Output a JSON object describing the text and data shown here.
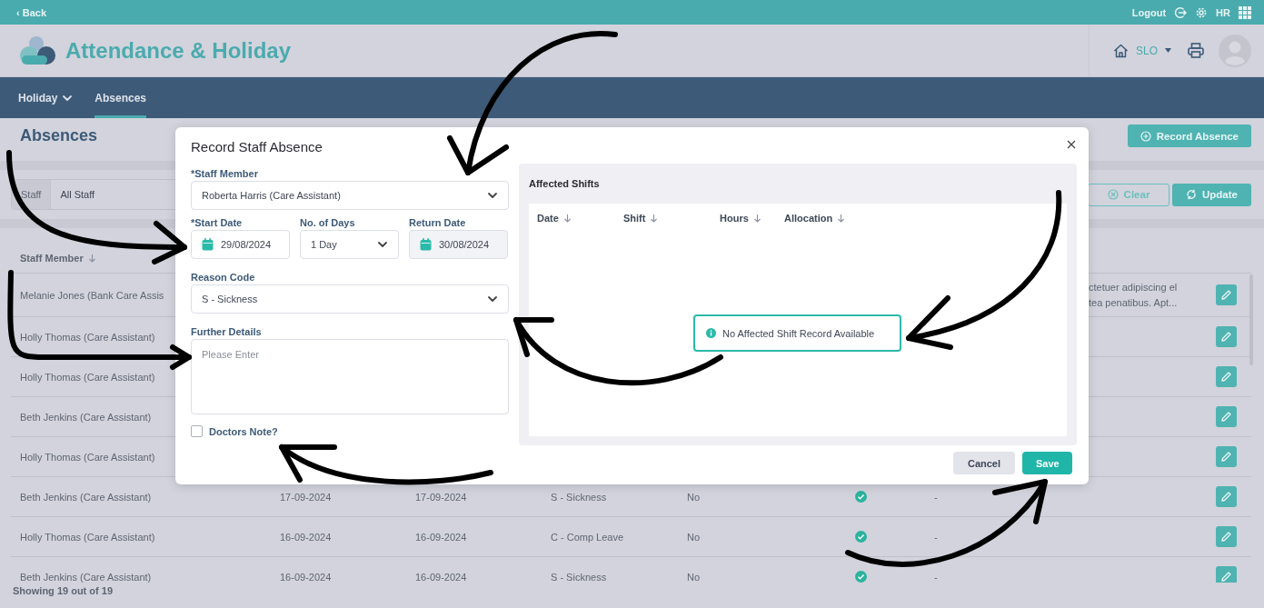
{
  "top_bar": {
    "back": "‹ Back",
    "logout": "Logout",
    "user_initials": "HR"
  },
  "header": {
    "title": "Attendance & Holiday",
    "site": "SLO"
  },
  "nav": {
    "items": [
      {
        "label": "Holiday",
        "has_dropdown": true,
        "selected": false
      },
      {
        "label": "Absences",
        "has_dropdown": false,
        "selected": true
      }
    ]
  },
  "page": {
    "title": "Absences",
    "record_button": "Record Absence"
  },
  "filters": {
    "label": "Staff",
    "value": "All Staff",
    "clear_button": "Clear",
    "update_button": "Update"
  },
  "table": {
    "columns": [
      {
        "label": "Staff Member"
      }
    ],
    "rows": [
      {
        "staff": "Melanie Jones (Bank Care Assis",
        "description": [
          "ctetuer adipiscing el",
          "tea penatibus. Apt..."
        ]
      },
      {
        "staff": "Holly Thomas (Care Assistant)"
      },
      {
        "staff": "Holly Thomas (Care Assistant)"
      },
      {
        "staff": "Beth Jenkins (Care Assistant)"
      },
      {
        "staff": "Holly Thomas (Care Assistant)"
      },
      {
        "staff": "Beth Jenkins (Care Assistant)",
        "start": "17-09-2024",
        "end": "17-09-2024",
        "reason": "S - Sickness",
        "doctors_note": "No",
        "approved": true,
        "notes": "-"
      },
      {
        "staff": "Holly Thomas (Care Assistant)",
        "start": "16-09-2024",
        "end": "16-09-2024",
        "reason": "C - Comp Leave",
        "doctors_note": "No",
        "approved": true,
        "notes": "-"
      },
      {
        "staff": "Beth Jenkins (Care Assistant)",
        "start": "16-09-2024",
        "end": "16-09-2024",
        "reason": "S - Sickness",
        "doctors_note": "No",
        "approved": true,
        "notes": "-"
      }
    ],
    "footer": "Showing 19 out of 19"
  },
  "modal": {
    "title": "Record Staff Absence",
    "staff_member": {
      "label": "*Staff Member",
      "value": "Roberta Harris (Care Assistant)"
    },
    "start_date": {
      "label": "*Start Date",
      "value": "29/08/2024"
    },
    "days": {
      "label": "No. of Days",
      "value": "1 Day"
    },
    "return_date": {
      "label": "Return Date",
      "value": "30/08/2024",
      "disabled": true
    },
    "reason": {
      "label": "Reason Code",
      "value": "S - Sickness"
    },
    "details": {
      "label": "Further Details",
      "placeholder": "Please Enter"
    },
    "doctors_note": {
      "label": "Doctors Note?",
      "checked": false
    },
    "affected_shifts": {
      "title": "Affected Shifts",
      "columns": [
        {
          "label": "Date"
        },
        {
          "label": "Shift"
        },
        {
          "label": "Hours"
        },
        {
          "label": "Allocation"
        }
      ],
      "empty_message": "No Affected Shift Record Available"
    },
    "cancel_button": "Cancel",
    "save_button": "Save"
  }
}
